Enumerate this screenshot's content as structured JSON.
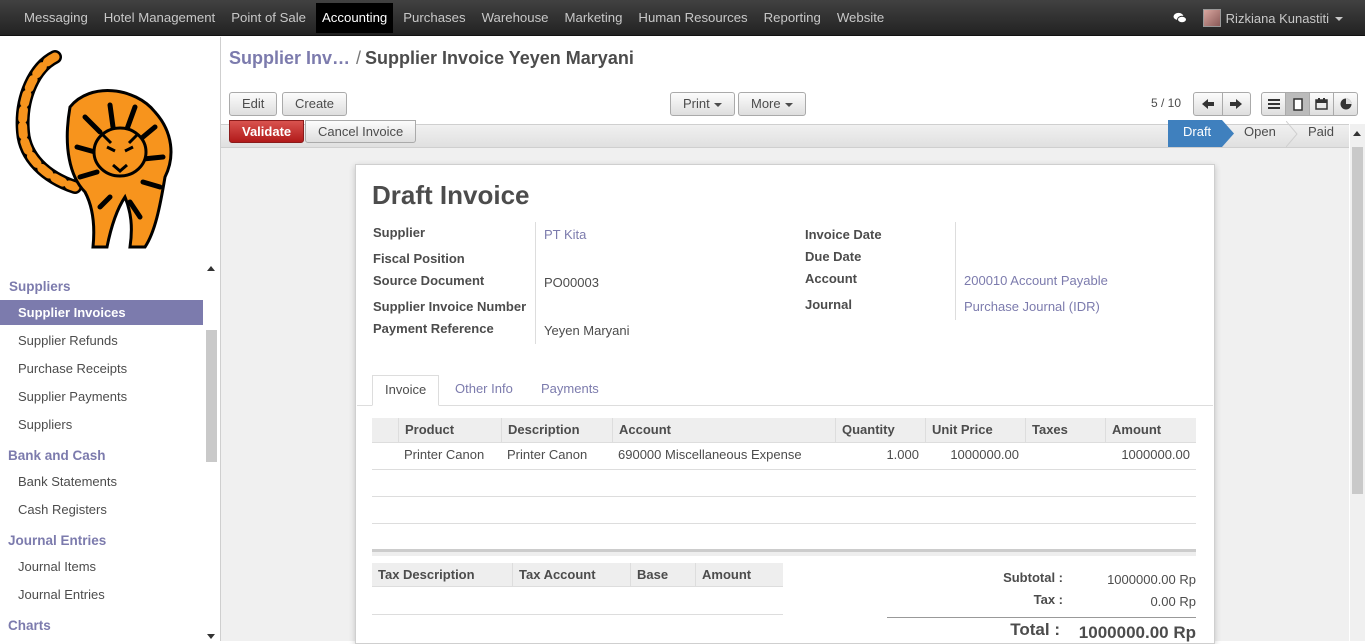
{
  "topmenu": {
    "items": [
      "Messaging",
      "Hotel Management",
      "Point of Sale",
      "Accounting",
      "Purchases",
      "Warehouse",
      "Marketing",
      "Human Resources",
      "Reporting",
      "Website"
    ],
    "active": "Accounting",
    "user": "Rizkiana Kunastiti",
    "chat_icon": "chat-bubbles-icon"
  },
  "sidebar": {
    "logo_icon": "tiger-logo",
    "sections": [
      {
        "header": "Suppliers",
        "items": [
          "Supplier Invoices",
          "Supplier Refunds",
          "Purchase Receipts",
          "Supplier Payments",
          "Suppliers"
        ]
      },
      {
        "header": "Bank and Cash",
        "items": [
          "Bank Statements",
          "Cash Registers"
        ]
      },
      {
        "header": "Journal Entries",
        "items": [
          "Journal Items",
          "Journal Entries"
        ]
      },
      {
        "header": "Charts",
        "items": []
      }
    ],
    "active_item": "Supplier Invoices"
  },
  "breadcrumb": {
    "parent": "Supplier Inv…",
    "separator": "/",
    "current": "Supplier Invoice Yeyen Maryani"
  },
  "toolbar": {
    "edit": "Edit",
    "create": "Create",
    "print": "Print",
    "more": "More",
    "pager": "5 / 10"
  },
  "statusbar": {
    "validate": "Validate",
    "cancel": "Cancel Invoice",
    "stages": [
      "Draft",
      "Open",
      "Paid"
    ],
    "current_stage": "Draft"
  },
  "form": {
    "title": "Draft Invoice",
    "left": {
      "supplier_label": "Supplier",
      "supplier_value": "PT Kita",
      "fiscal_label": "Fiscal Position",
      "fiscal_value": "",
      "source_label": "Source Document",
      "source_value": "PO00003",
      "supplier_inv_label": "Supplier Invoice Number",
      "supplier_inv_value": "",
      "payment_ref_label": "Payment Reference",
      "payment_ref_value": "Yeyen Maryani"
    },
    "right": {
      "invoice_date_label": "Invoice Date",
      "invoice_date_value": "",
      "due_date_label": "Due Date",
      "due_date_value": "",
      "account_label": "Account",
      "account_value": "200010 Account Payable",
      "journal_label": "Journal",
      "journal_value": "Purchase Journal (IDR)"
    },
    "tabs": [
      "Invoice",
      "Other Info",
      "Payments"
    ],
    "active_tab": "Invoice",
    "lines": {
      "columns": [
        "Product",
        "Description",
        "Account",
        "Quantity",
        "Unit Price",
        "Taxes",
        "Amount"
      ],
      "rows": [
        [
          "Printer Canon",
          "Printer Canon",
          "690000 Miscellaneous Expense",
          "1.000",
          "1000000.00",
          "",
          "1000000.00"
        ]
      ]
    },
    "taxes": {
      "columns": [
        "Tax Description",
        "Tax Account",
        "Base",
        "Amount"
      ]
    },
    "totals": {
      "subtotal_label": "Subtotal :",
      "subtotal_value": "1000000.00 Rp",
      "tax_label": "Tax :",
      "tax_value": "0.00 Rp",
      "total_label": "Total :",
      "total_value": "1000000.00 Rp"
    }
  }
}
